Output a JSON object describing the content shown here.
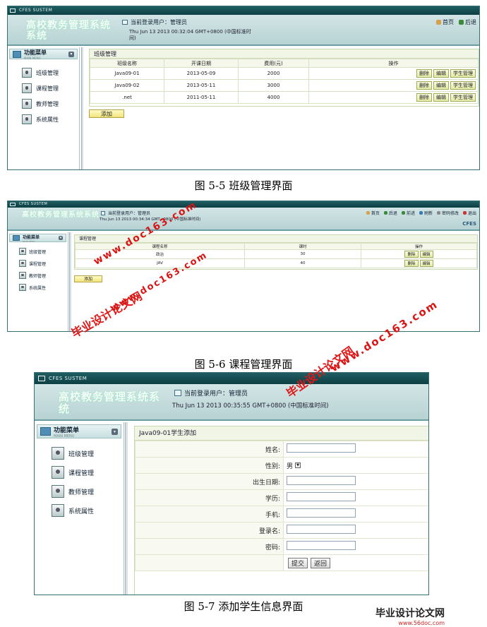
{
  "app_title": "CFES SUSTEM",
  "system_name": "高校教务管理系统系统",
  "current_user": "当前登录用户：管理员",
  "menu": {
    "title": "功能菜单",
    "subtitle": "MAIN MENU",
    "items": [
      "班级管理",
      "课程管理",
      "教师管理",
      "系统属性"
    ]
  },
  "screen1": {
    "clock": "Thu Jun 13 2013 00:32:04 GMT+0800 (中国标准时间)",
    "nav": [
      "首页",
      "后退"
    ],
    "panel_title": "班级管理",
    "headers": [
      "班级名称",
      "开课日期",
      "费用(元)",
      "操作"
    ],
    "rows": [
      [
        "Java09-01",
        "2013-05-09",
        "2000"
      ],
      [
        "Java09-02",
        "2013-05-11",
        "3000"
      ],
      [
        ".net",
        "2011-05-11",
        "4000"
      ]
    ],
    "row_actions": [
      "删除",
      "编辑",
      "学生管理"
    ],
    "add_button": "添加",
    "caption": "图 5-5 班级管理界面"
  },
  "screen2": {
    "clock": "Thu Jun 13 2013 00:34:34 GMT+0800 (中国标准时间)",
    "nav": [
      "首页",
      "后退",
      "前进",
      "刷新",
      "密码修改",
      "退出"
    ],
    "brand_right": "CFES",
    "panel_title": "课程管理",
    "headers": [
      "课程名称",
      "课时",
      "操作"
    ],
    "rows": [
      [
        "政治",
        "30"
      ],
      [
        "JAV",
        "40"
      ]
    ],
    "row_actions": [
      "删除",
      "编辑"
    ],
    "add_button": "添加",
    "caption": "图 5-6 课程管理界面"
  },
  "screen3": {
    "clock": "Thu Jun 13 2013 00:35:55 GMT+0800 (中国标准时间)",
    "panel_title": "Java09-01学生添加",
    "fields": {
      "name": "姓名:",
      "gender": "性别:",
      "gender_value": "男",
      "birth": "出生日期:",
      "education": "学历:",
      "phone": "手机:",
      "login": "登录名:",
      "password": "密码:"
    },
    "submit": "提交",
    "back": "返回",
    "caption": "图 5-7 添加学生信息界面"
  },
  "watermarks": {
    "cn": "毕业设计论文网",
    "url": "www.doc163.com",
    "footer_url": "www.56doc.com"
  },
  "colors": {
    "header_bg": "#c3dadb",
    "titlebar": "#17545a",
    "button_bg": "#eef2b8",
    "watermark": "#e01818"
  }
}
